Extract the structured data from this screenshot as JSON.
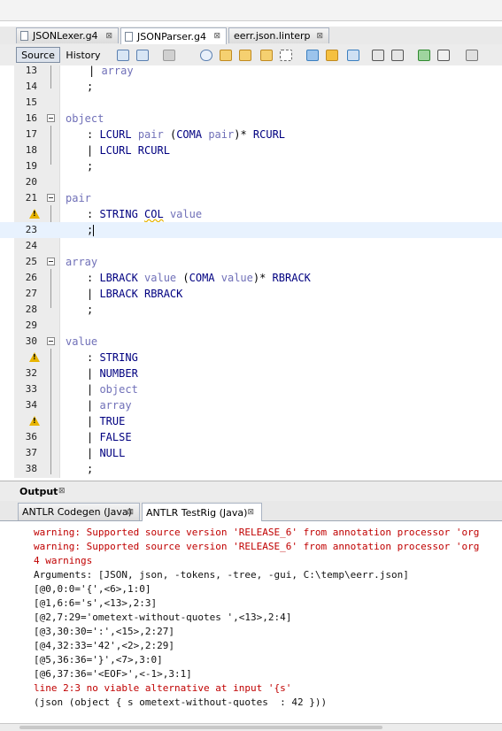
{
  "file_tabs": [
    {
      "label": "JSONLexer.g4",
      "close": "⊠",
      "active": false
    },
    {
      "label": "JSONParser.g4",
      "close": "⊠",
      "active": true
    },
    {
      "label": "eerr.json.linterp",
      "close": "⊠",
      "active": false
    }
  ],
  "toolbar": {
    "source_label": "Source",
    "history_label": "History",
    "icons": [
      "back-icon",
      "forward-icon",
      "last-edit-icon",
      "search-icon",
      "find-prev-icon",
      "find-next-icon",
      "toggle-highlight-icon",
      "select-icon",
      "prev-bookmark-icon",
      "next-bookmark-icon",
      "toggle-bookmark-icon",
      "shift-left-icon",
      "shift-right-icon",
      "comment-icon",
      "uncomment-icon",
      "macro-icon"
    ]
  },
  "code_lines": [
    {
      "num": "13",
      "text": "| array"
    },
    {
      "num": "14",
      "text": ";"
    },
    {
      "num": "15",
      "text": ""
    },
    {
      "num": "16",
      "text": "object"
    },
    {
      "num": "17",
      "text": ": LCURL pair (COMA pair)* RCURL"
    },
    {
      "num": "18",
      "text": "| LCURL RCURL"
    },
    {
      "num": "19",
      "text": ";"
    },
    {
      "num": "20",
      "text": ""
    },
    {
      "num": "21",
      "text": "pair"
    },
    {
      "num": "",
      "text": ": STRING COL value"
    },
    {
      "num": "23",
      "text": ";"
    },
    {
      "num": "24",
      "text": ""
    },
    {
      "num": "25",
      "text": "array"
    },
    {
      "num": "26",
      "text": ": LBRACK value (COMA value)* RBRACK"
    },
    {
      "num": "27",
      "text": "| LBRACK RBRACK"
    },
    {
      "num": "28",
      "text": ";"
    },
    {
      "num": "29",
      "text": ""
    },
    {
      "num": "30",
      "text": "value"
    },
    {
      "num": "",
      "text": ": STRING"
    },
    {
      "num": "32",
      "text": "| NUMBER"
    },
    {
      "num": "33",
      "text": "| object"
    },
    {
      "num": "34",
      "text": "| array"
    },
    {
      "num": "",
      "text": "| TRUE"
    },
    {
      "num": "36",
      "text": "| FALSE"
    },
    {
      "num": "37",
      "text": "| NULL"
    },
    {
      "num": "38",
      "text": ";"
    }
  ],
  "output_panel": {
    "title": "Output",
    "close": "⊠",
    "tabs": [
      {
        "label": "ANTLR Codegen (Java)",
        "close": "⊠",
        "active": false
      },
      {
        "label": "ANTLR TestRig (Java)",
        "close": "⊠",
        "active": true
      }
    ],
    "lines": [
      {
        "text": "warning: Supported source version 'RELEASE_6' from annotation processor 'org",
        "kind": "err"
      },
      {
        "text": "warning: Supported source version 'RELEASE_6' from annotation processor 'org",
        "kind": "err"
      },
      {
        "text": "4 warnings",
        "kind": "err"
      },
      {
        "text": "Arguments: [JSON, json, -tokens, -tree, -gui, C:\\temp\\eerr.json]",
        "kind": "norm"
      },
      {
        "text": "[@0,0:0='{',<6>,1:0]",
        "kind": "norm"
      },
      {
        "text": "[@1,6:6='s',<13>,2:3]",
        "kind": "norm"
      },
      {
        "text": "[@2,7:29='ometext-without-quotes ',<13>,2:4]",
        "kind": "norm"
      },
      {
        "text": "[@3,30:30=':',<15>,2:27]",
        "kind": "norm"
      },
      {
        "text": "[@4,32:33='42',<2>,2:29]",
        "kind": "norm"
      },
      {
        "text": "[@5,36:36='}',<7>,3:0]",
        "kind": "norm"
      },
      {
        "text": "[@6,37:36='<EOF>',<-1>,3:1]",
        "kind": "norm"
      },
      {
        "text": "line 2:3 no viable alternative at input '{s'",
        "kind": "err"
      },
      {
        "text": "(json (object { s ometext-without-quotes  : 42 }))",
        "kind": "norm"
      }
    ]
  },
  "colors": {
    "keyword": "#000080",
    "rule": "#7070b8",
    "error": "#c00000",
    "warning": "#e8b400",
    "current_line": "#e8f2fe"
  }
}
